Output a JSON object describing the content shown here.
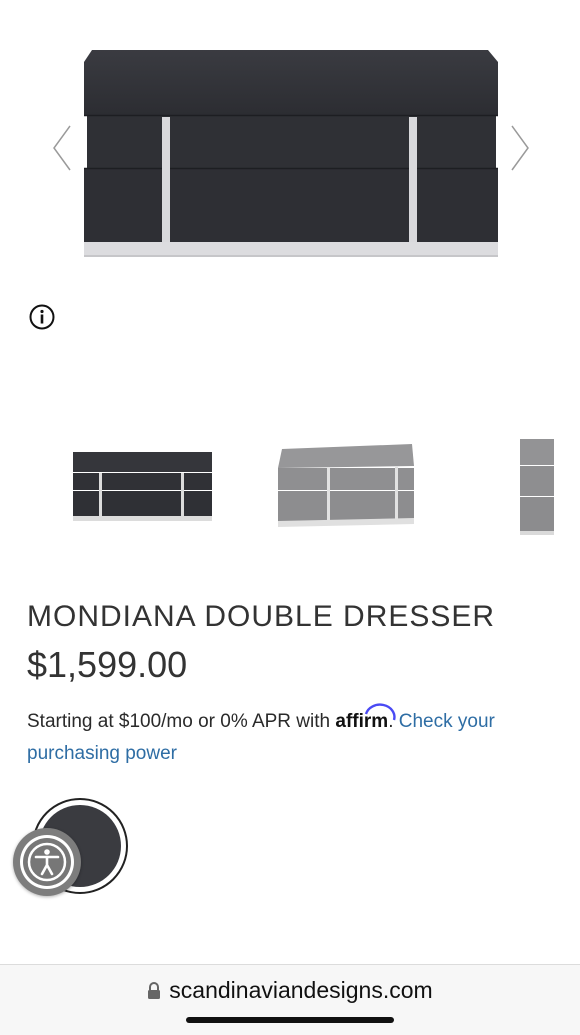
{
  "product": {
    "title": "MONDIANA DOUBLE DRESSER",
    "price": "$1,599.00"
  },
  "financing": {
    "prefix": "Starting at $100/mo or 0% APR with",
    "brand": "affirm",
    "suffix": ".",
    "link": "Check your purchasing power"
  },
  "gallery": {
    "prev_icon": "chevron-left-icon",
    "next_icon": "chevron-right-icon",
    "thumbnails": [
      "dark-grey-dresser",
      "light-grey-dresser",
      "grey-dresser-side"
    ]
  },
  "swatch": {
    "color": "#3a3b40"
  },
  "browser": {
    "domain": "scandinaviandesigns.com"
  }
}
